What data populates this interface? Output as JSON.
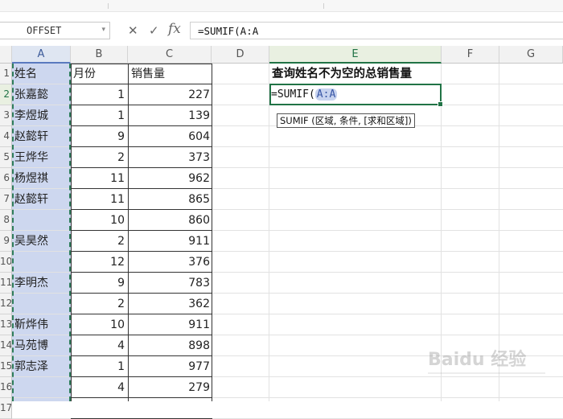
{
  "name_box": {
    "value": "OFFSET"
  },
  "formula_bar": {
    "cancel_icon": "close-icon",
    "confirm_icon": "check-icon",
    "fx_label": "fx",
    "value": "=SUMIF(A:A"
  },
  "columns": [
    "A",
    "B",
    "C",
    "D",
    "E",
    "F",
    "G"
  ],
  "rows": [
    "1",
    "2",
    "3",
    "4",
    "5",
    "6",
    "7",
    "8",
    "9",
    "10",
    "11",
    "12",
    "13",
    "14",
    "15",
    "16",
    "17"
  ],
  "headers": {
    "name": "姓名",
    "month": "月份",
    "sales": "销售量"
  },
  "data": [
    {
      "name": "张嘉懿",
      "month": "1",
      "sales": "227"
    },
    {
      "name": "李煜城",
      "month": "1",
      "sales": "139"
    },
    {
      "name": "赵懿轩",
      "month": "9",
      "sales": "604"
    },
    {
      "name": "王烨华",
      "month": "2",
      "sales": "373"
    },
    {
      "name": "杨煜祺",
      "month": "11",
      "sales": "962"
    },
    {
      "name": "赵懿轩",
      "month": "11",
      "sales": "865"
    },
    {
      "name": "",
      "month": "10",
      "sales": "860"
    },
    {
      "name": "吴昊然",
      "month": "2",
      "sales": "911"
    },
    {
      "name": "",
      "month": "12",
      "sales": "376"
    },
    {
      "name": "李明杰",
      "month": "9",
      "sales": "783"
    },
    {
      "name": "",
      "month": "2",
      "sales": "362"
    },
    {
      "name": "靳烨伟",
      "month": "10",
      "sales": "911"
    },
    {
      "name": "马苑博",
      "month": "4",
      "sales": "898"
    },
    {
      "name": "郭志泽",
      "month": "1",
      "sales": "977"
    },
    {
      "name": "",
      "month": "4",
      "sales": "279"
    }
  ],
  "e1_title": "查询姓名不为空的总销售量",
  "edit_cell": {
    "prefix": "=SUMIF(",
    "reference": "A:A"
  },
  "tooltip": "SUMIF (区域, 条件, [求和区域])",
  "watermark": "Baidu 经验",
  "colors": {
    "accent": "#217346",
    "selection": "#cdd7ef",
    "reference": "#3957a6"
  }
}
